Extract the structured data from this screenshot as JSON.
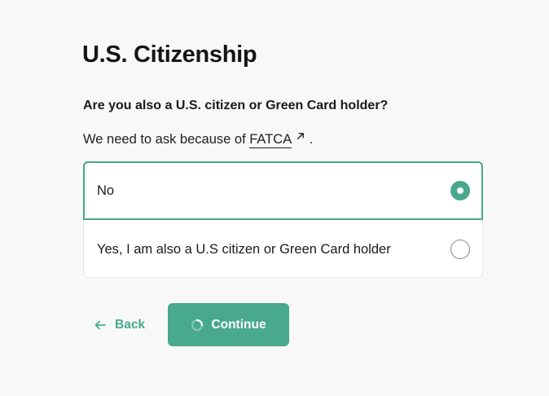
{
  "page": {
    "title": "U.S. Citizenship",
    "question": "Are you also a U.S. citizen or Green Card holder?",
    "helper_prefix": "We need to ask because of ",
    "helper_link": "FATCA",
    "helper_suffix": "."
  },
  "options": [
    {
      "label": "No",
      "selected": true
    },
    {
      "label": "Yes, I am also a U.S citizen or Green Card holder",
      "selected": false
    }
  ],
  "actions": {
    "back_label": "Back",
    "continue_label": "Continue",
    "continue_loading": true
  },
  "colors": {
    "accent": "#48a98c",
    "background": "#f8f8f8",
    "card": "#ffffff",
    "text": "#1a1a1a"
  },
  "icons": {
    "external_link": "external-link-icon",
    "back": "arrow-left-icon",
    "loading": "spinner-icon"
  }
}
